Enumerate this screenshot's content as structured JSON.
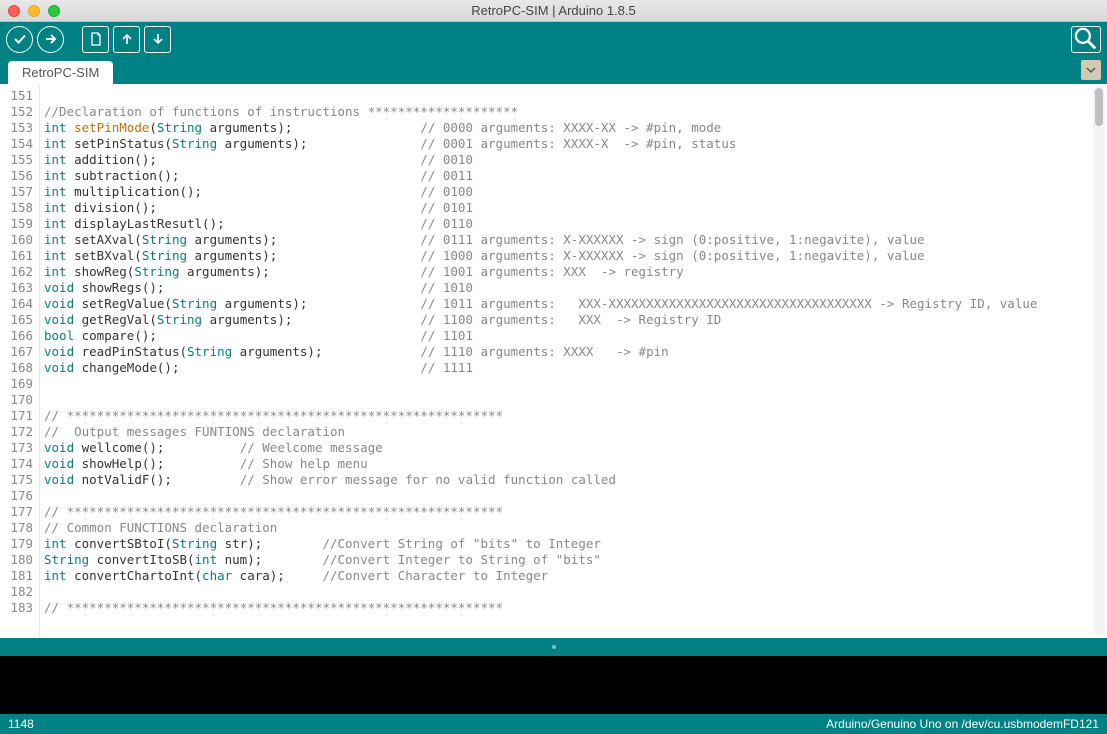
{
  "window": {
    "title": "RetroPC-SIM | Arduino 1.8.5"
  },
  "tab": {
    "label": "RetroPC-SIM"
  },
  "gutter_start": 151,
  "gutter_end": 183,
  "code_lines": [
    {
      "html": ""
    },
    {
      "html": "<span class='cm'>//Declaration of functions of instructions ********************</span>"
    },
    {
      "html": "<span class='kw'>int</span> <span class='fn'>setPinMode</span>(<span class='str'>String</span> arguments);                 <span class='cm'>// 0000 arguments: XXXX-XX -> #pin, mode</span>"
    },
    {
      "html": "<span class='kw'>int</span> setPinStatus(<span class='str'>String</span> arguments);               <span class='cm'>// 0001 arguments: XXXX-X  -> #pin, status</span>"
    },
    {
      "html": "<span class='kw'>int</span> addition();                                   <span class='cm'>// 0010</span>"
    },
    {
      "html": "<span class='kw'>int</span> subtraction();                                <span class='cm'>// 0011</span>"
    },
    {
      "html": "<span class='kw'>int</span> multiplication();                             <span class='cm'>// 0100</span>"
    },
    {
      "html": "<span class='kw'>int</span> division();                                   <span class='cm'>// 0101</span>"
    },
    {
      "html": "<span class='kw'>int</span> displayLastResutl();                          <span class='cm'>// 0110</span>"
    },
    {
      "html": "<span class='kw'>int</span> setAXval(<span class='str'>String</span> arguments);                   <span class='cm'>// 0111 arguments: X-XXXXXX -> sign (0:positive, 1:negavite), value</span>"
    },
    {
      "html": "<span class='kw'>int</span> setBXval(<span class='str'>String</span> arguments);                   <span class='cm'>// 1000 arguments: X-XXXXXX -> sign (0:positive, 1:negavite), value</span>"
    },
    {
      "html": "<span class='kw'>int</span> showReg(<span class='str'>String</span> arguments);                    <span class='cm'>// 1001 arguments: XXX  -> registry</span>"
    },
    {
      "html": "<span class='kw'>void</span> showRegs();                                  <span class='cm'>// 1010</span>"
    },
    {
      "html": "<span class='kw'>void</span> setRegValue(<span class='str'>String</span> arguments);               <span class='cm'>// 1011 arguments:   XXX-XXXXXXXXXXXXXXXXXXXXXXXXXXXXXXXXXXX -> Registry ID, value</span>"
    },
    {
      "html": "<span class='kw'>void</span> getRegVal(<span class='str'>String</span> arguments);                 <span class='cm'>// 1100 arguments:   XXX  -> Registry ID</span>"
    },
    {
      "html": "<span class='kw'>bool</span> compare();                                   <span class='cm'>// 1101</span>"
    },
    {
      "html": "<span class='kw'>void</span> readPinStatus(<span class='str'>String</span> arguments);             <span class='cm'>// 1110 arguments: XXXX   -> #pin</span>"
    },
    {
      "html": "<span class='kw'>void</span> changeMode();                                <span class='cm'>// 1111</span>"
    },
    {
      "html": ""
    },
    {
      "html": ""
    },
    {
      "html": "<span class='cm'>// **********************************************************</span>"
    },
    {
      "html": "<span class='cm'>//  Output messages FUNTIONS declaration</span>"
    },
    {
      "html": "<span class='kw'>void</span> wellcome();          <span class='cm'>// Weelcome message</span>"
    },
    {
      "html": "<span class='kw'>void</span> showHelp();          <span class='cm'>// Show help menu</span>"
    },
    {
      "html": "<span class='kw'>void</span> notValidF();         <span class='cm'>// Show error message for no valid function called</span>"
    },
    {
      "html": ""
    },
    {
      "html": "<span class='cm'>// **********************************************************</span>"
    },
    {
      "html": "<span class='cm'>// Common FUNCTIONS declaration</span>"
    },
    {
      "html": "<span class='kw'>int</span> convertSBtoI(<span class='str'>String</span> str);        <span class='cm'>//Convert String of \"bits\" to Integer</span>"
    },
    {
      "html": "<span class='str'>String</span> convertItoSB(<span class='kw'>int</span> num);        <span class='cm'>//Convert Integer to String of \"bits\"</span>"
    },
    {
      "html": "<span class='kw'>int</span> convertChartoInt(<span class='kw'>char</span> cara);     <span class='cm'>//Convert Character to Integer</span>"
    },
    {
      "html": ""
    },
    {
      "html": "<span class='cm'>// **********************************************************</span>"
    }
  ],
  "status": {
    "left": "1148",
    "right": "Arduino/Genuino Uno on /dev/cu.usbmodemFD121"
  }
}
